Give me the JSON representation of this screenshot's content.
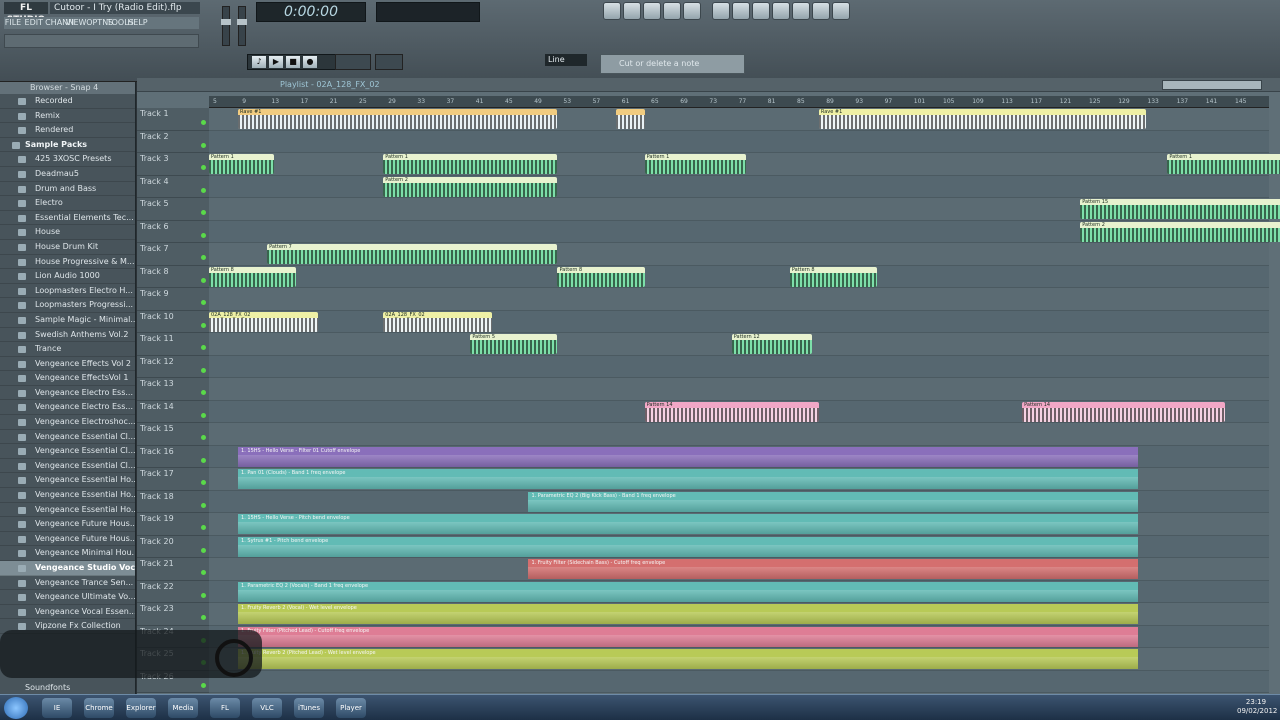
{
  "app": {
    "logo": "FL STUDIO",
    "window_title": "Cutoor - I Try (Radio Edit).flp",
    "time": "0:00:00",
    "snap": "Line",
    "hint": "Cut or delete a note"
  },
  "menu": [
    "FILE",
    "EDIT",
    "CHANN",
    "VIEW",
    "OPTNS",
    "TOOLS",
    "HELP"
  ],
  "transport_icons": [
    "pattern-song-icon",
    "play-icon",
    "stop-icon",
    "record-icon"
  ],
  "browser": {
    "title": "Browser - Snap 4",
    "items": [
      {
        "label": "Recorded",
        "kind": "folder"
      },
      {
        "label": "Remix",
        "kind": "folder"
      },
      {
        "label": "Rendered",
        "kind": "folder"
      },
      {
        "label": "Sample Packs",
        "kind": "group"
      },
      {
        "label": "425 3XOSC Presets",
        "kind": "folder"
      },
      {
        "label": "Deadmau5",
        "kind": "folder"
      },
      {
        "label": "Drum and Bass",
        "kind": "folder"
      },
      {
        "label": "Electro",
        "kind": "folder"
      },
      {
        "label": "Essential Elements Tec...",
        "kind": "folder"
      },
      {
        "label": "House",
        "kind": "folder"
      },
      {
        "label": "House Drum Kit",
        "kind": "folder"
      },
      {
        "label": "House Progressive & M...",
        "kind": "folder"
      },
      {
        "label": "Lion Audio 1000",
        "kind": "folder"
      },
      {
        "label": "Loopmasters Electro H...",
        "kind": "folder"
      },
      {
        "label": "Loopmasters Progressi...",
        "kind": "folder"
      },
      {
        "label": "Sample Magic - Minimal...",
        "kind": "folder"
      },
      {
        "label": "Swedish Anthems Vol.2",
        "kind": "folder"
      },
      {
        "label": "Trance",
        "kind": "folder"
      },
      {
        "label": "Vengeance Effects Vol 2",
        "kind": "folder"
      },
      {
        "label": "Vengeance EffectsVol 1",
        "kind": "folder"
      },
      {
        "label": "Vengeance Electro Ess...",
        "kind": "folder"
      },
      {
        "label": "Vengeance Electro Ess...",
        "kind": "folder"
      },
      {
        "label": "Vengeance Electroshoc...",
        "kind": "folder"
      },
      {
        "label": "Vengeance Essential Cl...",
        "kind": "folder"
      },
      {
        "label": "Vengeance Essential Cl...",
        "kind": "folder"
      },
      {
        "label": "Vengeance Essential Cl...",
        "kind": "folder"
      },
      {
        "label": "Vengeance Essential Ho...",
        "kind": "folder"
      },
      {
        "label": "Vengeance Essential Ho...",
        "kind": "folder"
      },
      {
        "label": "Vengeance Essential Ho...",
        "kind": "folder"
      },
      {
        "label": "Vengeance Future Hous...",
        "kind": "folder"
      },
      {
        "label": "Vengeance Future Hous...",
        "kind": "folder"
      },
      {
        "label": "Vengeance Minimal Hou...",
        "kind": "folder"
      },
      {
        "label": "Vengeance Studio Vocal...",
        "kind": "selected"
      },
      {
        "label": "Vengeance Trance Sen...",
        "kind": "folder"
      },
      {
        "label": "Vengeance Ultimate Vo...",
        "kind": "folder"
      },
      {
        "label": "Vengeance Vocal Essen...",
        "kind": "folder"
      },
      {
        "label": "Vipzone Fx Collection",
        "kind": "folder"
      }
    ],
    "footer": "Soundfonts"
  },
  "playlist": {
    "title": "Playlist - 02A_128_FX_02",
    "ruler": [
      "5",
      "9",
      "13",
      "17",
      "21",
      "25",
      "29",
      "33",
      "37",
      "41",
      "45",
      "49",
      "53",
      "57",
      "61",
      "65",
      "69",
      "73",
      "77",
      "81",
      "85",
      "89",
      "93",
      "97",
      "101",
      "105",
      "109",
      "113",
      "117",
      "121",
      "125",
      "129",
      "133",
      "137",
      "141",
      "145"
    ],
    "tracks": [
      "Track 1",
      "Track 2",
      "Track 3",
      "Track 4",
      "Track 5",
      "Track 6",
      "Track 7",
      "Track 8",
      "Track 9",
      "Track 10",
      "Track 11",
      "Track 12",
      "Track 13",
      "Track 14",
      "Track 15",
      "Track 16",
      "Track 17",
      "Track 18",
      "Track 19",
      "Track 20",
      "Track 21",
      "Track 22",
      "Track 23",
      "Track 24",
      "Track 25",
      "Track 26"
    ],
    "clips": [
      {
        "track": 1,
        "start": 5,
        "len": 44,
        "type": "audio",
        "label": "Rave #1"
      },
      {
        "track": 1,
        "start": 57,
        "len": 4,
        "type": "audio",
        "label": ""
      },
      {
        "track": 1,
        "start": 85,
        "len": 45,
        "type": "yellow",
        "label": "Rave #1"
      },
      {
        "track": 3,
        "start": 1,
        "len": 9,
        "type": "note",
        "label": "Pattern 1"
      },
      {
        "track": 3,
        "start": 25,
        "len": 24,
        "type": "note",
        "label": "Pattern 1"
      },
      {
        "track": 3,
        "start": 61,
        "len": 14,
        "type": "note",
        "label": "Pattern 1"
      },
      {
        "track": 3,
        "start": 133,
        "len": 28,
        "type": "note",
        "label": "Pattern 1"
      },
      {
        "track": 4,
        "start": 25,
        "len": 24,
        "type": "note",
        "label": "Pattern 2"
      },
      {
        "track": 5,
        "start": 121,
        "len": 36,
        "type": "note",
        "label": "Pattern 15"
      },
      {
        "track": 6,
        "start": 121,
        "len": 32,
        "type": "note",
        "label": "Pattern 2"
      },
      {
        "track": 7,
        "start": 9,
        "len": 40,
        "type": "note",
        "label": "Pattern 7"
      },
      {
        "track": 8,
        "start": 1,
        "len": 12,
        "type": "note",
        "label": "Pattern 8"
      },
      {
        "track": 8,
        "start": 49,
        "len": 12,
        "type": "note",
        "label": "Pattern 8"
      },
      {
        "track": 8,
        "start": 81,
        "len": 12,
        "type": "note",
        "label": "Pattern 8"
      },
      {
        "track": 10,
        "start": 1,
        "len": 15,
        "type": "yellow",
        "label": "02A_128_FX_02"
      },
      {
        "track": 10,
        "start": 25,
        "len": 15,
        "type": "yellow",
        "label": "02A_128_FX_02"
      },
      {
        "track": 11,
        "start": 37,
        "len": 12,
        "type": "note",
        "label": "Pattern 5"
      },
      {
        "track": 11,
        "start": 73,
        "len": 11,
        "type": "note",
        "label": "Pattern 12"
      },
      {
        "track": 14,
        "start": 61,
        "len": 24,
        "type": "pink",
        "label": "Pattern 14"
      },
      {
        "track": 14,
        "start": 113,
        "len": 28,
        "type": "pink",
        "label": "Pattern 14"
      }
    ],
    "automations": [
      {
        "track": 16,
        "start": 5,
        "len": 124,
        "type": "purple",
        "label": "1. 15HS - Hello Verse - Filter 01 Cutoff envelope"
      },
      {
        "track": 17,
        "start": 5,
        "len": 124,
        "type": "teal",
        "label": "1. Pan 01 (Clouds) - Band 1 freq envelope"
      },
      {
        "track": 18,
        "start": 45,
        "len": 84,
        "type": "teal",
        "label": "1. Parametric EQ 2 (Big Kick Bass) - Band 1 freq envelope"
      },
      {
        "track": 19,
        "start": 5,
        "len": 124,
        "type": "teal",
        "label": "1. 15HS - Hello Verse - Pitch bend envelope"
      },
      {
        "track": 20,
        "start": 5,
        "len": 124,
        "type": "teal",
        "label": "1. Sytrus #1 - Pitch bend envelope"
      },
      {
        "track": 21,
        "start": 45,
        "len": 84,
        "type": "red",
        "label": "1. Fruity Filter (Sidechain Bass) - Cutoff freq envelope"
      },
      {
        "track": 22,
        "start": 5,
        "len": 124,
        "type": "teal",
        "label": "1. Parametric EQ 2 (Vocals) - Band 1 freq envelope"
      },
      {
        "track": 23,
        "start": 5,
        "len": 124,
        "type": "lime",
        "label": "1. Fruity Reverb 2 (Vocal) - Wet level envelope"
      },
      {
        "track": 24,
        "start": 5,
        "len": 124,
        "type": "pink",
        "label": "1. Fruity Filter (Pitched Lead) - Cutoff freq envelope"
      },
      {
        "track": 25,
        "start": 5,
        "len": 124,
        "type": "lime",
        "label": "1. Fruity Reverb 2 (Pitched Lead) - Wet level envelope"
      }
    ]
  },
  "taskbar": {
    "clock": "23:19",
    "date": "09/02/2012",
    "buttons": [
      "IE",
      "Chrome",
      "Explorer",
      "Media",
      "FL",
      "VLC",
      "iTunes",
      "Player"
    ]
  }
}
